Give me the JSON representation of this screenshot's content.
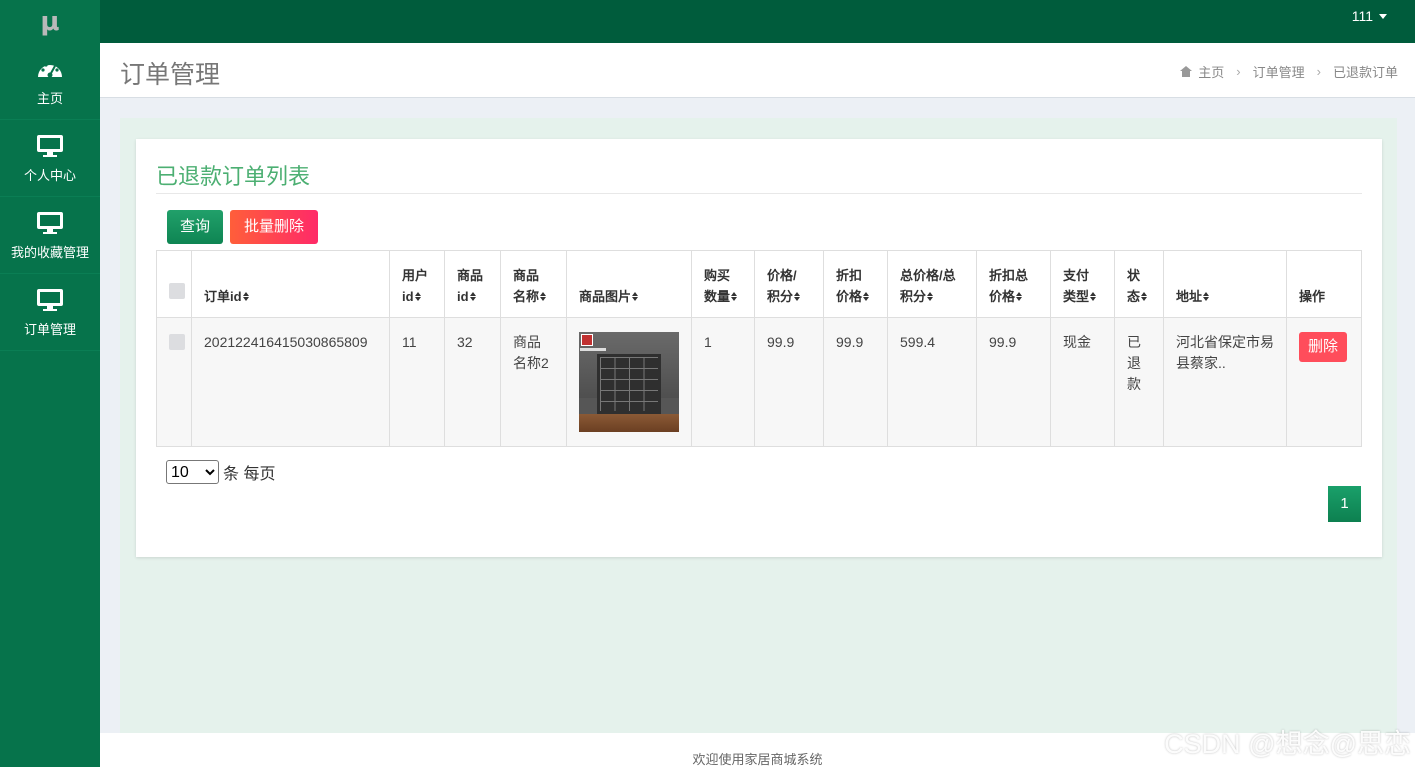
{
  "brand": {
    "logo": "μ"
  },
  "user_menu": {
    "name": "111"
  },
  "sidebar": {
    "items": [
      {
        "label": "主页",
        "icon": "dashboard-icon"
      },
      {
        "label": "个人中心",
        "icon": "monitor-icon"
      },
      {
        "label": "我的收藏管理",
        "icon": "monitor-icon"
      },
      {
        "label": "订单管理",
        "icon": "monitor-icon"
      }
    ]
  },
  "header": {
    "title": "订单管理",
    "breadcrumb": [
      "主页",
      "订单管理",
      "已退款订单"
    ]
  },
  "card": {
    "title": "已退款订单列表",
    "query_label": "查询",
    "batch_delete_label": "批量删除"
  },
  "table": {
    "columns": [
      [
        "订单id"
      ],
      [
        "用户",
        "id"
      ],
      [
        "商品",
        "id"
      ],
      [
        "商品",
        "名称"
      ],
      [
        "商品图片"
      ],
      [
        "购买",
        "数量"
      ],
      [
        "价格/",
        "积分"
      ],
      [
        "折扣",
        "价格"
      ],
      [
        "总价格/总",
        "积分"
      ],
      [
        "折扣总",
        "价格"
      ],
      [
        "支付",
        "类型"
      ],
      [
        "状",
        "态"
      ],
      [
        "地址"
      ],
      [
        "操作"
      ]
    ],
    "rows": [
      {
        "order_id": "20212241641503086 5809",
        "user_id": "11",
        "product_id": "32",
        "product_name": [
          "商品",
          "名称2"
        ],
        "quantity": "1",
        "price": "99.9",
        "discount_price": "99.9",
        "total_price": "599.4",
        "discount_total": "99.9",
        "payment_type": "现金",
        "status": [
          "已",
          "退",
          "款"
        ],
        "address": [
          "河北省保定市易",
          "县蔡家.."
        ],
        "delete_label": "删除"
      }
    ]
  },
  "pagination": {
    "page_size": "10",
    "page_size_options": [
      "10"
    ],
    "page_size_suffix": "条 每页",
    "current_page": "1"
  },
  "footer": {
    "text": "欢迎使用家居商城系统"
  },
  "watermark": "CSDN @想念@思恋",
  "colors": {
    "topbar": "#005c3c",
    "sidebar": "#06734b",
    "accent_green": "#4caf72",
    "danger": "#ff4d5b"
  }
}
